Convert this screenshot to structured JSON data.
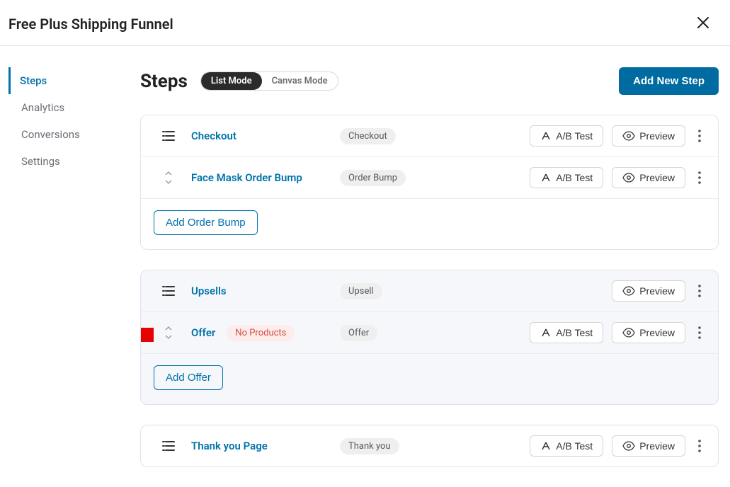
{
  "header": {
    "title": "Free Plus Shipping Funnel"
  },
  "sidebar": {
    "items": [
      "Steps",
      "Analytics",
      "Conversions",
      "Settings"
    ],
    "activeIndex": 0
  },
  "main": {
    "title": "Steps",
    "modes": {
      "list": "List Mode",
      "canvas": "Canvas Mode"
    },
    "addNew": "Add New Step",
    "buttons": {
      "abtest": "A/B Test",
      "preview": "Preview"
    },
    "groups": [
      {
        "highlight": false,
        "rows": [
          {
            "icon": "list",
            "title": "Checkout",
            "badge": "Checkout",
            "actions": [
              "ab",
              "preview",
              "more"
            ]
          },
          {
            "icon": "sort",
            "title": "Face Mask Order Bump",
            "badge": "Order Bump",
            "actions": [
              "ab",
              "preview",
              "more"
            ]
          }
        ],
        "addButton": "Add Order Bump"
      },
      {
        "highlight": true,
        "rows": [
          {
            "icon": "list",
            "title": "Upsells",
            "badge": "Upsell",
            "actions": [
              "preview",
              "more"
            ]
          },
          {
            "icon": "sort",
            "title": "Offer",
            "warn": "No Products",
            "badge": "Offer",
            "actions": [
              "ab",
              "preview",
              "more"
            ],
            "pointer": true
          }
        ],
        "addButton": "Add Offer"
      },
      {
        "highlight": false,
        "rows": [
          {
            "icon": "list",
            "title": "Thank you Page",
            "badge": "Thank you",
            "actions": [
              "ab",
              "preview",
              "more"
            ]
          }
        ]
      }
    ]
  }
}
